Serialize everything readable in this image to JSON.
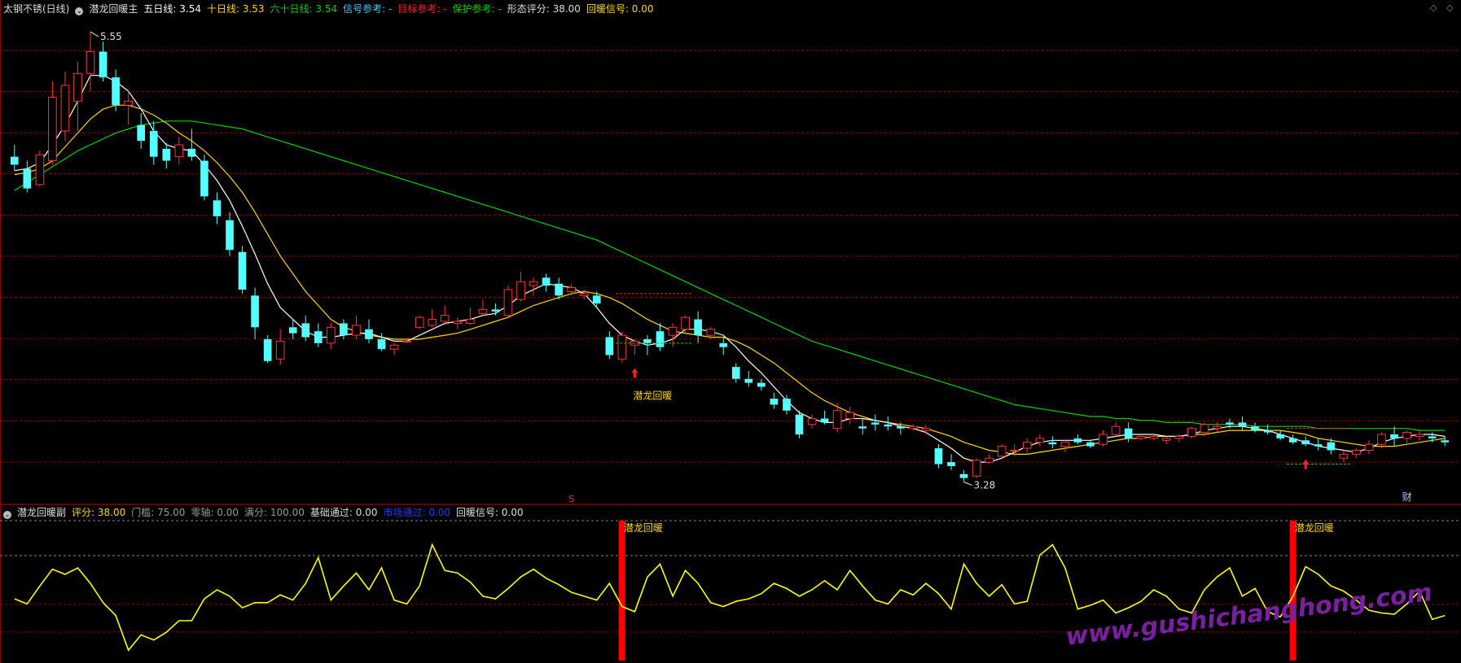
{
  "main_header": {
    "stock": "太钢不锈(日线)",
    "indicator": "潜龙回暖主",
    "ma5": "五日线: 3.54",
    "ma10": "十日线: 3.53",
    "ma60": "六十日线: 3.54",
    "signal_ref": "信号参考: -",
    "target_ref": "目标参考: -",
    "protect_ref": "保护参考: -",
    "shape_score": "形态评分: 38.00",
    "warm_signal": "回暖信号: 0.00"
  },
  "sub_header": {
    "indicator": "潜龙回暖副",
    "score": "评分: 38.00",
    "threshold": "门槛: 75.00",
    "zero_axis": "零轴: 0.00",
    "full": "满分: 100.00",
    "basic_pass": "基础通过: 0.00",
    "market_pass": "市场通过: 0.00",
    "warm_signal": "回暖信号: 0.00"
  },
  "annotations": {
    "high": "5.55",
    "low": "3.28",
    "signal_label_main": "潜龙回暖",
    "signal_label_sub": "潜龙回暖",
    "marker_s": "S",
    "marker_cai": "财"
  },
  "watermark": "www.gushichanghong.com",
  "colors": {
    "up": "#ff3232",
    "down": "#54ffff",
    "ma5": "#ffffff",
    "ma10": "#ffd700",
    "ma60": "#00d200",
    "grid": "#8b0000",
    "score_line": "#ffff00",
    "signal_bar": "#ff0000",
    "watermark": "#7a1fa2"
  },
  "chart_data": [
    {
      "type": "candlestick",
      "title": "潜龙回暖主",
      "ylim": [
        3.2,
        5.62
      ],
      "highest": 5.55,
      "lowest": 3.28,
      "ohlc": [
        [
          4.92,
          4.98,
          4.85,
          4.88
        ],
        [
          4.86,
          4.9,
          4.74,
          4.76
        ],
        [
          4.78,
          4.95,
          4.77,
          4.93
        ],
        [
          4.9,
          5.3,
          4.88,
          5.22
        ],
        [
          5.05,
          5.35,
          5.0,
          5.28
        ],
        [
          5.2,
          5.4,
          5.05,
          5.34
        ],
        [
          5.34,
          5.55,
          5.25,
          5.45
        ],
        [
          5.45,
          5.5,
          5.3,
          5.32
        ],
        [
          5.32,
          5.36,
          5.15,
          5.18
        ],
        [
          5.18,
          5.26,
          5.08,
          5.2
        ],
        [
          5.08,
          5.14,
          4.96,
          5.0
        ],
        [
          5.05,
          5.1,
          4.88,
          4.92
        ],
        [
          4.96,
          4.99,
          4.86,
          4.9
        ],
        [
          4.92,
          5.02,
          4.88,
          4.98
        ],
        [
          4.96,
          5.06,
          4.9,
          4.92
        ],
        [
          4.9,
          4.93,
          4.7,
          4.72
        ],
        [
          4.7,
          4.74,
          4.58,
          4.62
        ],
        [
          4.6,
          4.64,
          4.42,
          4.45
        ],
        [
          4.44,
          4.47,
          4.23,
          4.25
        ],
        [
          4.22,
          4.26,
          4.0,
          4.06
        ],
        [
          4.0,
          4.02,
          3.88,
          3.89
        ],
        [
          3.9,
          4.05,
          3.87,
          3.99
        ],
        [
          4.06,
          4.1,
          4.0,
          4.03
        ],
        [
          4.08,
          4.12,
          3.99,
          4.01
        ],
        [
          4.04,
          4.08,
          3.96,
          3.98
        ],
        [
          3.98,
          4.08,
          3.95,
          4.06
        ],
        [
          4.08,
          4.1,
          4.0,
          4.02
        ],
        [
          4.02,
          4.12,
          4.0,
          4.07
        ],
        [
          4.05,
          4.1,
          3.98,
          4.0
        ],
        [
          4.0,
          4.03,
          3.94,
          3.95
        ],
        [
          3.95,
          3.98,
          3.92,
          3.97
        ],
        [
          3.99,
          4.0,
          3.98,
          3.99
        ],
        [
          4.06,
          4.12,
          4.05,
          4.11
        ],
        [
          4.07,
          4.15,
          4.06,
          4.1
        ],
        [
          4.09,
          4.17,
          4.07,
          4.12
        ],
        [
          4.08,
          4.11,
          4.05,
          4.09
        ],
        [
          4.08,
          4.16,
          4.07,
          4.1
        ],
        [
          4.13,
          4.2,
          4.12,
          4.15
        ],
        [
          4.15,
          4.18,
          4.12,
          4.14
        ],
        [
          4.12,
          4.27,
          4.11,
          4.25
        ],
        [
          4.2,
          4.34,
          4.19,
          4.29
        ],
        [
          4.27,
          4.31,
          4.22,
          4.29
        ],
        [
          4.31,
          4.33,
          4.24,
          4.27
        ],
        [
          4.28,
          4.31,
          4.2,
          4.22
        ],
        [
          4.24,
          4.28,
          4.22,
          4.26
        ],
        [
          4.22,
          4.25,
          4.2,
          4.23
        ],
        [
          4.22,
          4.24,
          4.16,
          4.18
        ],
        [
          4.01,
          4.04,
          3.9,
          3.92
        ],
        [
          3.9,
          4.04,
          3.88,
          4.02
        ],
        [
          3.97,
          4.0,
          3.92,
          3.99
        ],
        [
          4.0,
          4.02,
          3.92,
          3.98
        ],
        [
          4.04,
          4.08,
          3.94,
          3.96
        ],
        [
          4.02,
          4.08,
          3.96,
          4.06
        ],
        [
          4.05,
          4.12,
          4.03,
          4.11
        ],
        [
          4.1,
          4.14,
          3.98,
          4.02
        ],
        [
          4.02,
          4.06,
          4.0,
          4.05
        ],
        [
          3.98,
          4.01,
          3.92,
          3.96
        ],
        [
          3.86,
          3.88,
          3.78,
          3.8
        ],
        [
          3.8,
          3.84,
          3.76,
          3.78
        ],
        [
          3.78,
          3.8,
          3.74,
          3.76
        ],
        [
          3.7,
          3.73,
          3.65,
          3.67
        ],
        [
          3.7,
          3.72,
          3.62,
          3.64
        ],
        [
          3.62,
          3.64,
          3.5,
          3.52
        ],
        [
          3.57,
          3.62,
          3.55,
          3.6
        ],
        [
          3.6,
          3.64,
          3.57,
          3.58
        ],
        [
          3.55,
          3.68,
          3.53,
          3.64
        ],
        [
          3.6,
          3.66,
          3.57,
          3.63
        ],
        [
          3.56,
          3.6,
          3.52,
          3.55
        ],
        [
          3.58,
          3.62,
          3.54,
          3.57
        ],
        [
          3.57,
          3.61,
          3.54,
          3.56
        ],
        [
          3.56,
          3.58,
          3.52,
          3.55
        ],
        [
          3.55,
          3.57,
          3.54,
          3.56
        ],
        [
          3.54,
          3.57,
          3.52,
          3.55
        ],
        [
          3.45,
          3.47,
          3.35,
          3.37
        ],
        [
          3.38,
          3.42,
          3.34,
          3.36
        ],
        [
          3.32,
          3.34,
          3.28,
          3.3
        ],
        [
          3.31,
          3.4,
          3.3,
          3.39
        ],
        [
          3.38,
          3.42,
          3.37,
          3.4
        ],
        [
          3.41,
          3.47,
          3.4,
          3.46
        ],
        [
          3.44,
          3.47,
          3.41,
          3.44
        ],
        [
          3.45,
          3.5,
          3.43,
          3.48
        ],
        [
          3.48,
          3.52,
          3.46,
          3.5
        ],
        [
          3.48,
          3.51,
          3.45,
          3.47
        ],
        [
          3.46,
          3.49,
          3.43,
          3.48
        ],
        [
          3.5,
          3.52,
          3.47,
          3.48
        ],
        [
          3.48,
          3.49,
          3.45,
          3.46
        ],
        [
          3.47,
          3.54,
          3.46,
          3.52
        ],
        [
          3.52,
          3.58,
          3.51,
          3.56
        ],
        [
          3.55,
          3.58,
          3.48,
          3.5
        ],
        [
          3.5,
          3.52,
          3.49,
          3.51
        ],
        [
          3.5,
          3.52,
          3.49,
          3.51
        ],
        [
          3.49,
          3.51,
          3.47,
          3.5
        ],
        [
          3.5,
          3.52,
          3.48,
          3.51
        ],
        [
          3.51,
          3.56,
          3.5,
          3.55
        ],
        [
          3.53,
          3.58,
          3.51,
          3.57
        ],
        [
          3.55,
          3.58,
          3.53,
          3.56
        ],
        [
          3.58,
          3.6,
          3.55,
          3.57
        ],
        [
          3.58,
          3.61,
          3.54,
          3.56
        ],
        [
          3.56,
          3.58,
          3.53,
          3.54
        ],
        [
          3.54,
          3.57,
          3.52,
          3.53
        ],
        [
          3.52,
          3.54,
          3.49,
          3.5
        ],
        [
          3.5,
          3.52,
          3.47,
          3.48
        ],
        [
          3.49,
          3.51,
          3.46,
          3.47
        ],
        [
          3.47,
          3.5,
          3.44,
          3.46
        ],
        [
          3.48,
          3.5,
          3.42,
          3.44
        ],
        [
          3.4,
          3.44,
          3.38,
          3.42
        ],
        [
          3.42,
          3.45,
          3.4,
          3.44
        ],
        [
          3.44,
          3.49,
          3.42,
          3.47
        ],
        [
          3.47,
          3.53,
          3.45,
          3.52
        ],
        [
          3.52,
          3.56,
          3.46,
          3.5
        ],
        [
          3.5,
          3.54,
          3.47,
          3.53
        ],
        [
          3.51,
          3.54,
          3.49,
          3.52
        ],
        [
          3.51,
          3.53,
          3.48,
          3.5
        ],
        [
          3.49,
          3.51,
          3.46,
          3.48
        ]
      ],
      "ma5": [
        4.85,
        4.86,
        4.89,
        4.98,
        5.08,
        5.2,
        5.33,
        5.33,
        5.3,
        5.25,
        5.16,
        5.05,
        4.98,
        4.96,
        4.95,
        4.88,
        4.8,
        4.7,
        4.57,
        4.43,
        4.28,
        4.16,
        4.1,
        4.04,
        4.01,
        4.01,
        4.02,
        4.03,
        4.03,
        4.01,
        3.99,
        3.99,
        4.02,
        4.05,
        4.08,
        4.09,
        4.1,
        4.12,
        4.13,
        4.17,
        4.22,
        4.25,
        4.28,
        4.27,
        4.26,
        4.23,
        4.16,
        4.08,
        4.02,
        3.99,
        3.97,
        3.98,
        4.0,
        4.05,
        4.05,
        4.04,
        4.02,
        3.96,
        3.89,
        3.83,
        3.76,
        3.69,
        3.63,
        3.6,
        3.58,
        3.58,
        3.6,
        3.6,
        3.59,
        3.58,
        3.56,
        3.55,
        3.53,
        3.49,
        3.45,
        3.4,
        3.38,
        3.38,
        3.4,
        3.43,
        3.46,
        3.48,
        3.49,
        3.49,
        3.49,
        3.49,
        3.5,
        3.51,
        3.52,
        3.52,
        3.52,
        3.51,
        3.51,
        3.52,
        3.54,
        3.55,
        3.56,
        3.56,
        3.55,
        3.54,
        3.52,
        3.5,
        3.48,
        3.46,
        3.45,
        3.44,
        3.43,
        3.45,
        3.48,
        3.5,
        3.51,
        3.52,
        3.52,
        3.51
      ],
      "ma10": [
        4.83,
        4.84,
        4.86,
        4.9,
        4.97,
        5.04,
        5.11,
        5.16,
        5.18,
        5.18,
        5.16,
        5.13,
        5.09,
        5.04,
        5.0,
        4.95,
        4.89,
        4.82,
        4.74,
        4.64,
        4.53,
        4.42,
        4.33,
        4.24,
        4.17,
        4.1,
        4.06,
        4.04,
        4.02,
        4.01,
        4.0,
        4.0,
        4.0,
        4.01,
        4.02,
        4.03,
        4.05,
        4.07,
        4.09,
        4.11,
        4.14,
        4.17,
        4.19,
        4.21,
        4.23,
        4.24,
        4.23,
        4.21,
        4.18,
        4.14,
        4.1,
        4.07,
        4.04,
        4.03,
        4.02,
        4.01,
        4.01,
        3.99,
        3.96,
        3.92,
        3.88,
        3.83,
        3.78,
        3.73,
        3.69,
        3.66,
        3.63,
        3.61,
        3.59,
        3.58,
        3.57,
        3.56,
        3.55,
        3.53,
        3.51,
        3.48,
        3.46,
        3.44,
        3.43,
        3.42,
        3.42,
        3.43,
        3.44,
        3.45,
        3.46,
        3.47,
        3.48,
        3.49,
        3.5,
        3.5,
        3.51,
        3.51,
        3.51,
        3.52,
        3.52,
        3.53,
        3.54,
        3.54,
        3.54,
        3.54,
        3.54,
        3.53,
        3.52,
        3.5,
        3.49,
        3.48,
        3.47,
        3.46,
        3.46,
        3.46,
        3.47,
        3.48,
        3.49,
        3.5
      ],
      "ma60": [
        4.75,
        4.79,
        4.83,
        4.87,
        4.91,
        4.95,
        4.98,
        5.01,
        5.04,
        5.06,
        5.08,
        5.09,
        5.1,
        5.1,
        5.1,
        5.09,
        5.08,
        5.07,
        5.06,
        5.04,
        5.02,
        5.0,
        4.98,
        4.96,
        4.94,
        4.92,
        4.9,
        4.88,
        4.86,
        4.84,
        4.82,
        4.8,
        4.78,
        4.76,
        4.74,
        4.72,
        4.7,
        4.68,
        4.66,
        4.64,
        4.62,
        4.6,
        4.58,
        4.56,
        4.54,
        4.52,
        4.5,
        4.47,
        4.44,
        4.41,
        4.38,
        4.35,
        4.32,
        4.29,
        4.26,
        4.23,
        4.2,
        4.17,
        4.14,
        4.11,
        4.08,
        4.05,
        4.02,
        3.99,
        3.97,
        3.95,
        3.93,
        3.91,
        3.89,
        3.87,
        3.85,
        3.83,
        3.81,
        3.79,
        3.77,
        3.75,
        3.73,
        3.71,
        3.69,
        3.67,
        3.66,
        3.65,
        3.64,
        3.63,
        3.62,
        3.61,
        3.61,
        3.6,
        3.6,
        3.59,
        3.59,
        3.58,
        3.58,
        3.58,
        3.57,
        3.57,
        3.57,
        3.57,
        3.56,
        3.56,
        3.56,
        3.56,
        3.56,
        3.55,
        3.55,
        3.55,
        3.55,
        3.55,
        3.55,
        3.55,
        3.55,
        3.54,
        3.54,
        3.54
      ],
      "signal_up_arrows_at": [
        49,
        102
      ],
      "signal_ref_box": [
        {
          "from": 48,
          "to": 53,
          "top": 4.23,
          "bottom": 3.98
        },
        {
          "from": 101,
          "to": 105,
          "top": 3.55,
          "bottom": 3.37
        }
      ]
    },
    {
      "type": "line",
      "title": "潜龙回暖副",
      "ylim": [
        0,
        110
      ],
      "threshold": 75,
      "series": [
        {
          "name": "评分",
          "values": [
            48,
            44,
            58,
            71,
            67,
            72,
            60,
            45,
            35,
            8,
            20,
            16,
            22,
            31,
            31,
            48,
            55,
            50,
            41,
            45,
            45,
            51,
            47,
            60,
            80,
            47,
            58,
            68,
            55,
            72,
            47,
            44,
            58,
            90,
            70,
            68,
            61,
            50,
            48,
            56,
            65,
            71,
            64,
            59,
            53,
            50,
            47,
            60,
            42,
            38,
            65,
            75,
            50,
            70,
            60,
            45,
            42,
            46,
            48,
            52,
            60,
            56,
            50,
            55,
            62,
            55,
            70,
            58,
            47,
            44,
            55,
            51,
            60,
            52,
            40,
            75,
            60,
            50,
            59,
            44,
            46,
            82,
            90,
            72,
            40,
            43,
            47,
            37,
            41,
            46,
            55,
            50,
            40,
            37,
            55,
            65,
            72,
            50,
            56,
            38,
            34,
            50,
            73,
            67,
            58,
            54,
            47,
            39,
            37,
            36,
            44,
            54,
            32,
            35
          ]
        },
        {
          "name": "回暖信号",
          "bars_at": [
            48,
            101
          ]
        }
      ]
    }
  ]
}
